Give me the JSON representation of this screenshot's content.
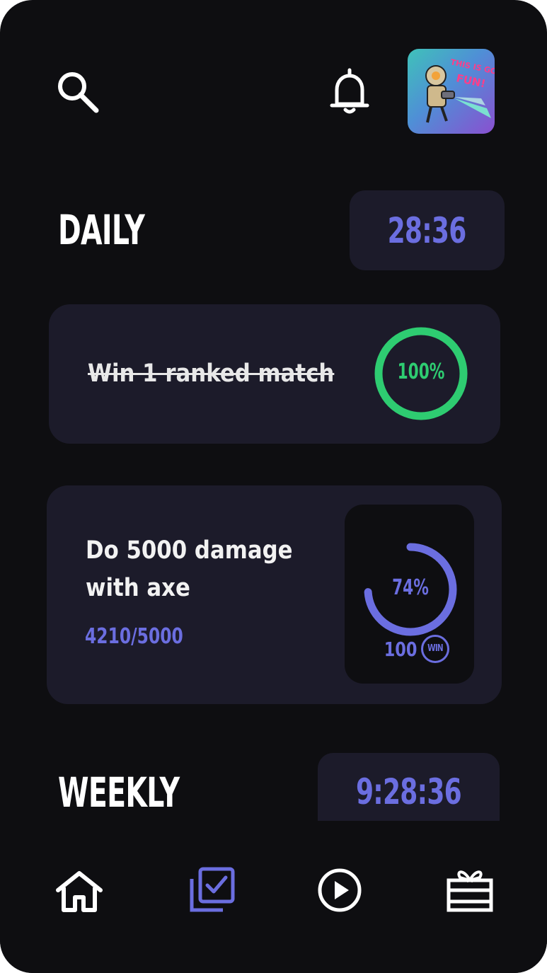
{
  "header": {
    "search_icon": "search-icon",
    "bell_icon": "bell-icon",
    "avatar_text": "THIS IS GOING TO BE FUN!"
  },
  "daily": {
    "title": "DAILY",
    "timer": "28:36",
    "tasks": [
      {
        "text": "Win 1 ranked match",
        "completed": true,
        "percent_label": "100%",
        "progress": 1.0
      },
      {
        "text_line1": "Do 5000 damage",
        "text_line2": "with axe",
        "progress_text": "4210/5000",
        "percent_label": "74%",
        "progress": 0.74,
        "reward_amount": "100",
        "reward_currency": "WIN"
      }
    ]
  },
  "weekly": {
    "title": "WEEKLY",
    "timer": "9:28:36"
  },
  "nav": {
    "items": [
      "home-icon",
      "tasks-icon",
      "play-icon",
      "gift-icon"
    ],
    "active": "tasks-icon"
  },
  "colors": {
    "background": "#0e0e11",
    "card": "#1c1b2a",
    "accent": "#6b6ee0",
    "success": "#2ecc71"
  }
}
